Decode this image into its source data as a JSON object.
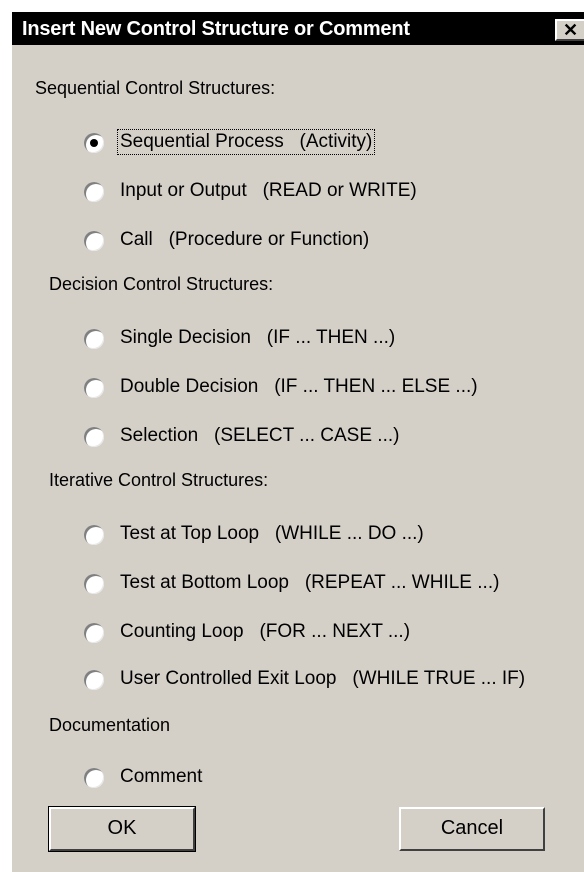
{
  "dialog": {
    "title": "Insert New Control Structure or Comment",
    "close_glyph": "✕"
  },
  "sections": {
    "sequential": "Sequential Control Structures:",
    "decision": "Decision Control Structures:",
    "iterative": "Iterative Control Structures:",
    "documentation": "Documentation"
  },
  "options": {
    "sequential_process": "Sequential Process   (Activity)",
    "input_output": "Input or Output   (READ or WRITE)",
    "call": "Call   (Procedure or Function)",
    "single_decision": "Single Decision   (IF ... THEN ...)",
    "double_decision": "Double Decision   (IF ... THEN ... ELSE ...)",
    "selection": "Selection   (SELECT ... CASE ...)",
    "test_top": "Test at Top Loop   (WHILE ... DO ...)",
    "test_bottom": "Test at Bottom Loop   (REPEAT ... WHILE ...)",
    "counting": "Counting Loop   (FOR ... NEXT ...)",
    "user_exit": "User Controlled Exit Loop   (WHILE TRUE ... IF)",
    "comment": "Comment"
  },
  "selected_option": "sequential_process",
  "buttons": {
    "ok": "OK",
    "cancel": "Cancel"
  }
}
